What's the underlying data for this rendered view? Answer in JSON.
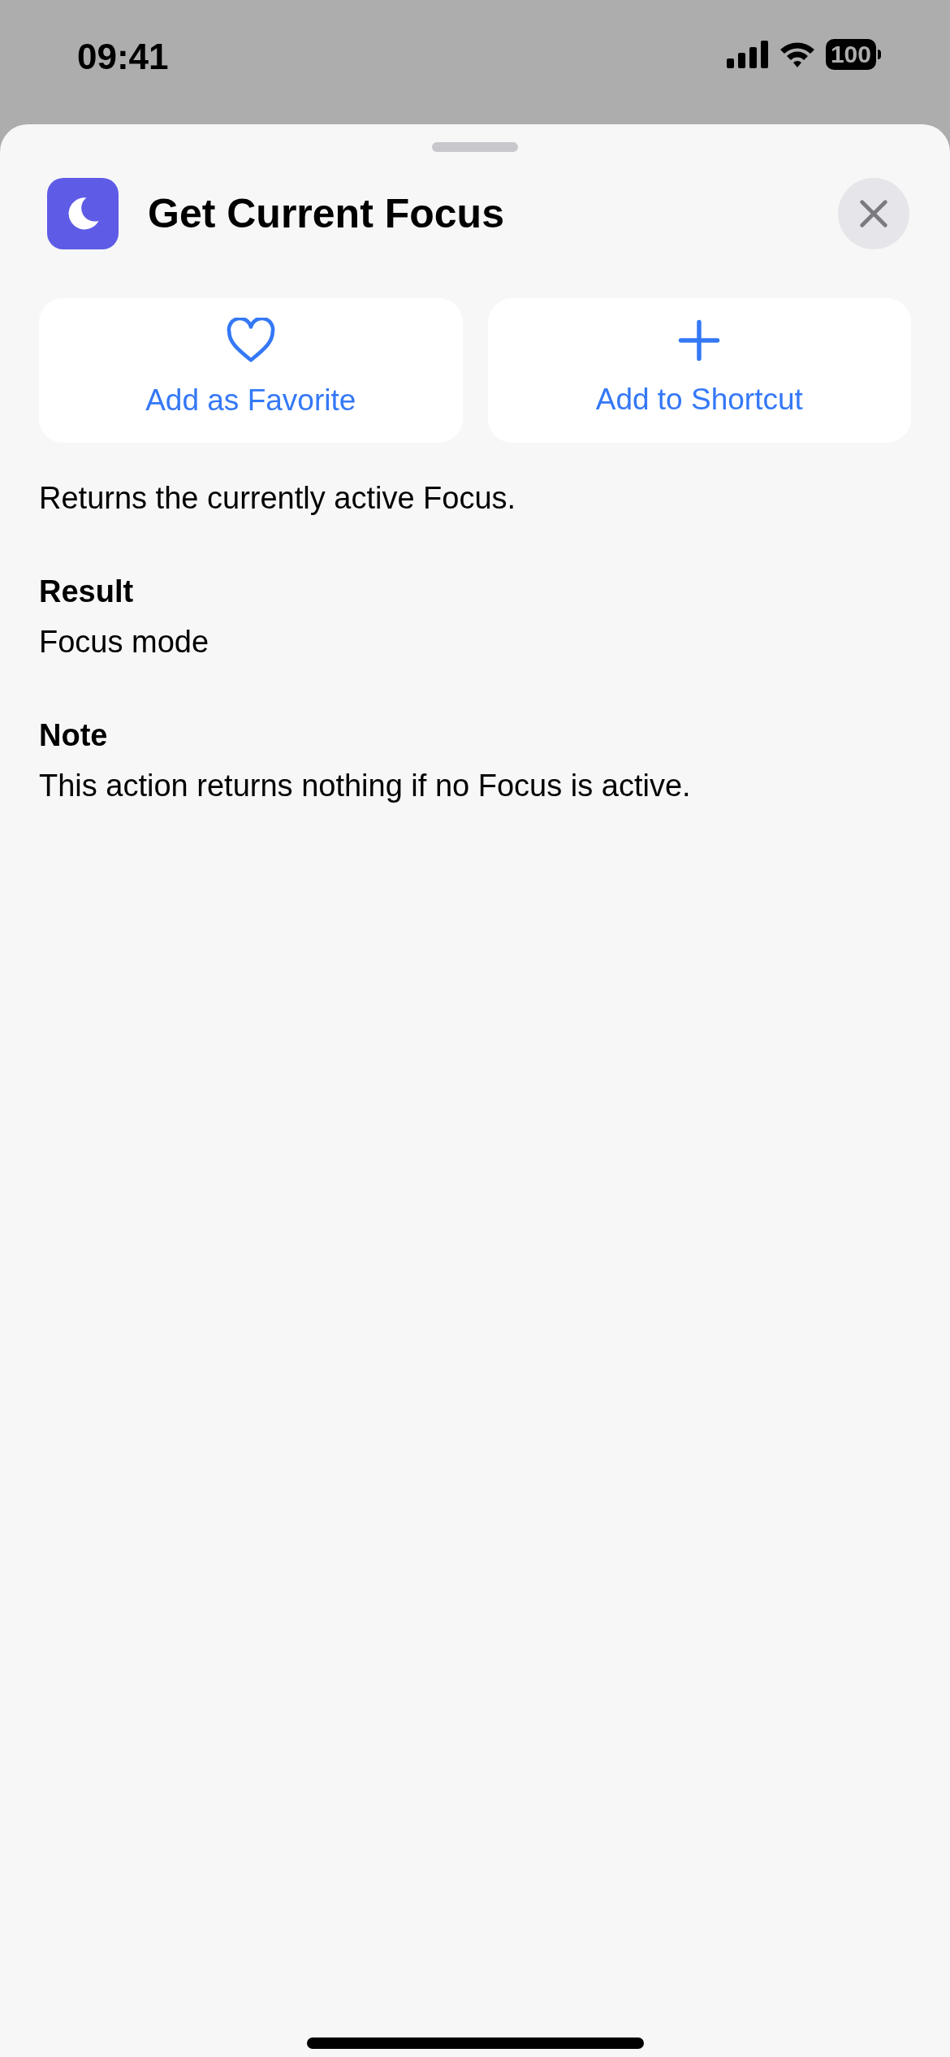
{
  "status_bar": {
    "time": "09:41",
    "battery": "100"
  },
  "sheet": {
    "title": "Get Current Focus",
    "buttons": [
      {
        "kind": "favorite",
        "label": "Add as Favorite"
      },
      {
        "kind": "add",
        "label": "Add to Shortcut"
      }
    ],
    "description": "Returns the currently active Focus.",
    "sections": [
      {
        "heading": "Result",
        "text": "Focus mode"
      },
      {
        "heading": "Note",
        "text": "This action returns nothing if no Focus is active."
      }
    ]
  }
}
